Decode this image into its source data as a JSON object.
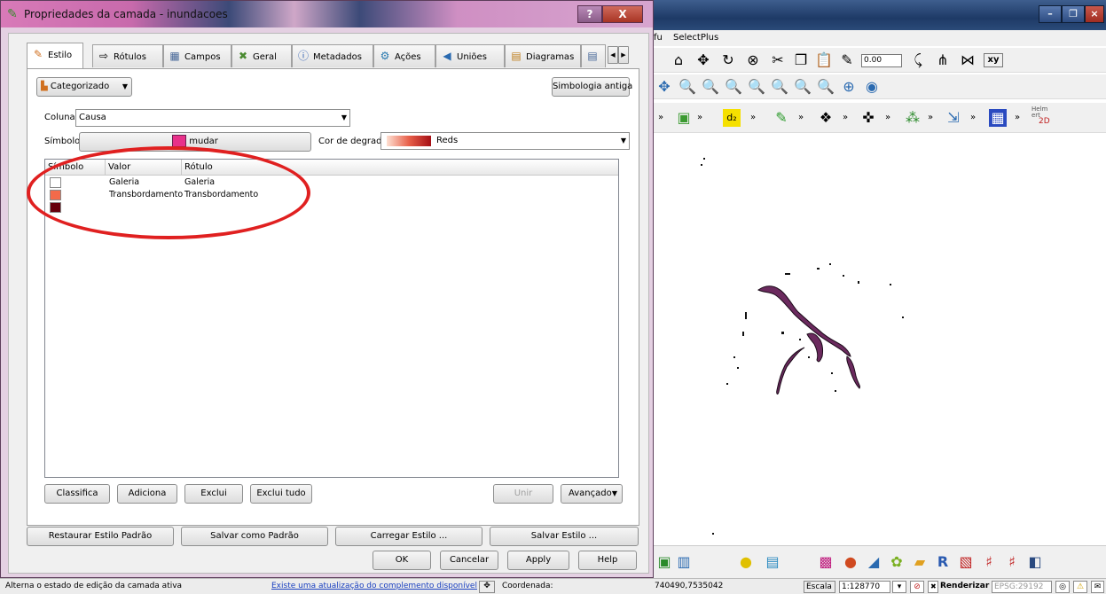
{
  "dialog": {
    "title": "Propriedades da camada - inundacoes",
    "title_buttons": {
      "help": "?",
      "close": "X"
    },
    "tabs": [
      {
        "label": "Estilo",
        "icon": "paintbrush-icon"
      },
      {
        "label": "Rótulos",
        "icon": "label-icon"
      },
      {
        "label": "Campos",
        "icon": "table-icon"
      },
      {
        "label": "Geral",
        "icon": "tools-icon"
      },
      {
        "label": "Metadados",
        "icon": "info-icon"
      },
      {
        "label": "Ações",
        "icon": "gears-icon"
      },
      {
        "label": "Uniões",
        "icon": "join-icon"
      },
      {
        "label": "Diagramas",
        "icon": "diagram-icon"
      }
    ],
    "renderer_type": "Categorizado",
    "old_symbology_button": "Simbologia antiga",
    "column_label": "Coluna",
    "column_value": "Causa",
    "symbol_label": "Símbolo",
    "symbol_change": "mudar",
    "gradient_label": "Cor de degradê",
    "gradient_value": "Reds",
    "list_headers": [
      "Símbolo",
      "Valor",
      "Rótulo"
    ],
    "rows": [
      {
        "value": "Galeria",
        "label": "Galeria",
        "color": "#ffffff"
      },
      {
        "value": "Transbordamento",
        "label": "Transbordamento",
        "color": "#f26a4a"
      },
      {
        "value": "",
        "label": "",
        "color": "#67000d"
      }
    ],
    "buttons": {
      "classify": "Classifica",
      "add": "Adiciona",
      "delete": "Exclui",
      "delete_all": "Exclui tudo",
      "join": "Unir",
      "advanced": "Avançado"
    },
    "style_buttons": {
      "restore": "Restaurar Estilo Padrão",
      "save_default": "Salvar como Padrão",
      "load": "Carregar Estilo ...",
      "save": "Salvar Estilo ..."
    },
    "action_buttons": {
      "ok": "OK",
      "cancel": "Cancelar",
      "apply": "Apply",
      "help": "Help"
    }
  },
  "main_window": {
    "menu_items": [
      "fu",
      "SelectPlus"
    ],
    "scale_value_text": "0.00",
    "helmert_label": "Helm ert",
    "helmert_sub": "2D"
  },
  "statusbar": {
    "message": "Alterna o estado de edição da camada ativa",
    "update_link": "Existe uma atualização do complemento disponível",
    "coord_label": "Coordenada:",
    "coords": "740490,7535042",
    "scale_label": "Escala",
    "scale_value": "1:128770",
    "render_label": "Renderizar",
    "crs": "EPSG:29192"
  },
  "colors": {
    "symbol_swatch": "#e8318a",
    "map_features": "#6b2a5e",
    "highlight": "#e02020"
  }
}
